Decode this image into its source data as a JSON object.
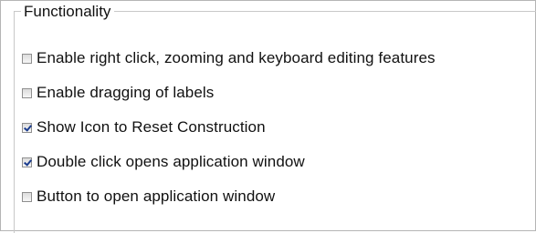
{
  "group": {
    "title": "Functionality"
  },
  "options": [
    {
      "label": "Enable right click, zooming and keyboard editing features",
      "checked": false
    },
    {
      "label": "Enable dragging of labels",
      "checked": false
    },
    {
      "label": "Show Icon to Reset Construction",
      "checked": true
    },
    {
      "label": "Double click opens application window",
      "checked": true
    },
    {
      "label": "Button to open application window",
      "checked": false
    }
  ]
}
